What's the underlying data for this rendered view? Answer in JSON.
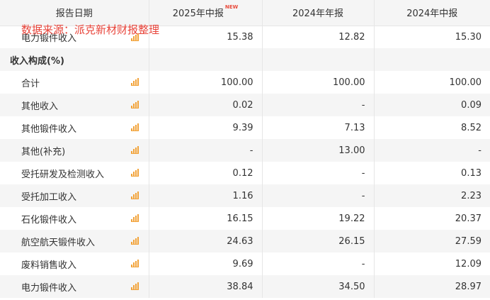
{
  "header": {
    "col_date": "报告日期",
    "col_1": "2025年中报",
    "col_1_badge": "NEW",
    "col_2": "2024年年报",
    "col_3": "2024年中报"
  },
  "watermark": "数据来源：派克新材财报整理",
  "rows": [
    {
      "name": "电力锻件收入",
      "v1": "15.38",
      "v2": "12.82",
      "v3": "15.30",
      "icon": "bar-chart-icon"
    },
    {
      "name": "收入构成(%)",
      "section": true
    },
    {
      "name": "合计",
      "v1": "100.00",
      "v2": "100.00",
      "v3": "100.00",
      "icon": "bar-chart-icon"
    },
    {
      "name": "其他收入",
      "v1": "0.02",
      "v2": "-",
      "v3": "0.09",
      "icon": "bar-chart-icon"
    },
    {
      "name": "其他锻件收入",
      "v1": "9.39",
      "v2": "7.13",
      "v3": "8.52",
      "icon": "bar-chart-icon"
    },
    {
      "name": "其他(补充)",
      "v1": "-",
      "v2": "13.00",
      "v3": "-",
      "icon": "bar-chart-icon"
    },
    {
      "name": "受托研发及检测收入",
      "v1": "0.12",
      "v2": "-",
      "v3": "0.13",
      "icon": "bar-chart-icon"
    },
    {
      "name": "受托加工收入",
      "v1": "1.16",
      "v2": "-",
      "v3": "2.23",
      "icon": "bar-chart-icon"
    },
    {
      "name": "石化锻件收入",
      "v1": "16.15",
      "v2": "19.22",
      "v3": "20.37",
      "icon": "bar-chart-icon"
    },
    {
      "name": "航空航天锻件收入",
      "v1": "24.63",
      "v2": "26.15",
      "v3": "27.59",
      "icon": "bar-chart-icon"
    },
    {
      "name": "废料销售收入",
      "v1": "9.69",
      "v2": "-",
      "v3": "12.09",
      "icon": "bar-chart-icon"
    },
    {
      "name": "电力锻件收入",
      "v1": "38.84",
      "v2": "34.50",
      "v3": "28.97",
      "icon": "bar-chart-icon"
    }
  ],
  "colors": {
    "accent_icon": "#f2a33a",
    "watermark": "#e8443a",
    "badge": "#e94b3c",
    "stripe": "#f5f5f5"
  }
}
